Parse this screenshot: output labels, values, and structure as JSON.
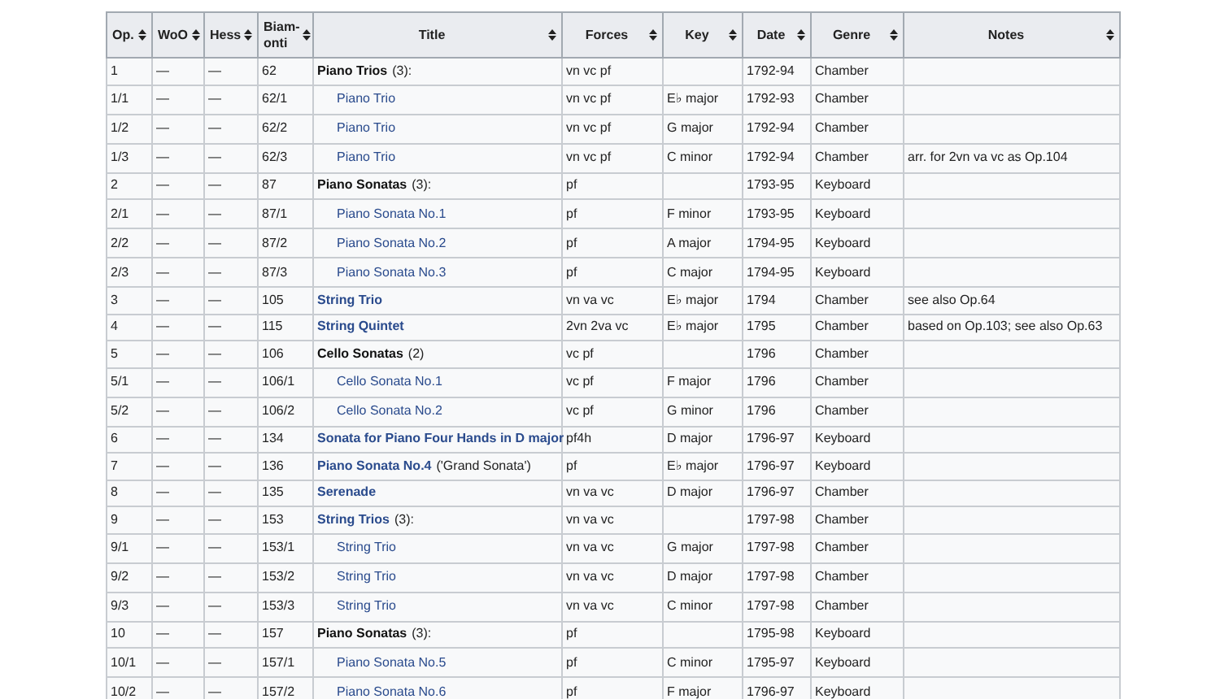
{
  "table": {
    "columns": [
      "Op.",
      "WoO",
      "Hess",
      "Biam- onti",
      "Title",
      "Forces",
      "Key",
      "Date",
      "Genre",
      "Notes"
    ],
    "rows": [
      {
        "op": "1",
        "woo": "—",
        "hess": "—",
        "biamonti": "62",
        "title": {
          "kind": "group",
          "link": false,
          "text": "Piano Trios",
          "suffix": "(3):"
        },
        "forces": "vn vc pf",
        "date": "1792-94",
        "genre": "Chamber"
      },
      {
        "op": "1/1",
        "woo": "—",
        "hess": "—",
        "biamonti": "62/1",
        "title": {
          "kind": "sub",
          "link": true,
          "text": "Piano Trio"
        },
        "forces": "vn vc pf",
        "key": "E♭ major",
        "date": "1792-93",
        "genre": "Chamber"
      },
      {
        "op": "1/2",
        "woo": "—",
        "hess": "—",
        "biamonti": "62/2",
        "title": {
          "kind": "sub",
          "link": true,
          "text": "Piano Trio"
        },
        "forces": "vn vc pf",
        "key": "G major",
        "date": "1792-94",
        "genre": "Chamber"
      },
      {
        "op": "1/3",
        "woo": "—",
        "hess": "—",
        "biamonti": "62/3",
        "title": {
          "kind": "sub",
          "link": true,
          "text": "Piano Trio"
        },
        "forces": "vn vc pf",
        "key": "C minor",
        "date": "1792-94",
        "genre": "Chamber",
        "notes": "arr. for 2vn va vc as Op.104"
      },
      {
        "op": "2",
        "woo": "—",
        "hess": "—",
        "biamonti": "87",
        "title": {
          "kind": "group",
          "link": false,
          "text": "Piano Sonatas",
          "suffix": "(3):"
        },
        "forces": "pf",
        "date": "1793-95",
        "genre": "Keyboard"
      },
      {
        "op": "2/1",
        "woo": "—",
        "hess": "—",
        "biamonti": "87/1",
        "title": {
          "kind": "sub",
          "link": true,
          "text": "Piano Sonata No.1"
        },
        "forces": "pf",
        "key": "F minor",
        "date": "1793-95",
        "genre": "Keyboard"
      },
      {
        "op": "2/2",
        "woo": "—",
        "hess": "—",
        "biamonti": "87/2",
        "title": {
          "kind": "sub",
          "link": true,
          "text": "Piano Sonata No.2"
        },
        "forces": "pf",
        "key": "A major",
        "date": "1794-95",
        "genre": "Keyboard"
      },
      {
        "op": "2/3",
        "woo": "—",
        "hess": "—",
        "biamonti": "87/3",
        "title": {
          "kind": "sub",
          "link": true,
          "text": "Piano Sonata No.3"
        },
        "forces": "pf",
        "key": "C major",
        "date": "1794-95",
        "genre": "Keyboard"
      },
      {
        "op": "3",
        "woo": "—",
        "hess": "—",
        "biamonti": "105",
        "title": {
          "kind": "group",
          "link": true,
          "text": "String Trio"
        },
        "forces": "vn va vc",
        "key": "E♭ major",
        "date": "1794",
        "genre": "Chamber",
        "notes": "see also Op.64"
      },
      {
        "op": "4",
        "woo": "—",
        "hess": "—",
        "biamonti": "115",
        "title": {
          "kind": "group",
          "link": true,
          "text": "String Quintet"
        },
        "forces": "2vn 2va vc",
        "key": "E♭ major",
        "date": "1795",
        "genre": "Chamber",
        "notes": "based on Op.103; see also Op.63"
      },
      {
        "op": "5",
        "woo": "—",
        "hess": "—",
        "biamonti": "106",
        "title": {
          "kind": "group",
          "link": false,
          "text": "Cello Sonatas",
          "suffix": "(2)"
        },
        "forces": "vc pf",
        "date": "1796",
        "genre": "Chamber"
      },
      {
        "op": "5/1",
        "woo": "—",
        "hess": "—",
        "biamonti": "106/1",
        "title": {
          "kind": "sub",
          "link": true,
          "text": "Cello Sonata No.1"
        },
        "forces": "vc pf",
        "key": "F major",
        "date": "1796",
        "genre": "Chamber"
      },
      {
        "op": "5/2",
        "woo": "—",
        "hess": "—",
        "biamonti": "106/2",
        "title": {
          "kind": "sub",
          "link": true,
          "text": "Cello Sonata No.2"
        },
        "forces": "vc pf",
        "key": "G minor",
        "date": "1796",
        "genre": "Chamber"
      },
      {
        "op": "6",
        "woo": "—",
        "hess": "—",
        "biamonti": "134",
        "title": {
          "kind": "group",
          "link": true,
          "text": "Sonata for Piano Four Hands in D major"
        },
        "forces": "pf4h",
        "key": "D major",
        "date": "1796-97",
        "genre": "Keyboard"
      },
      {
        "op": "7",
        "woo": "—",
        "hess": "—",
        "biamonti": "136",
        "title": {
          "kind": "group",
          "link": true,
          "text": "Piano Sonata No.4",
          "suffix": "('Grand Sonata')"
        },
        "forces": "pf",
        "key": "E♭ major",
        "date": "1796-97",
        "genre": "Keyboard"
      },
      {
        "op": "8",
        "woo": "—",
        "hess": "—",
        "biamonti": "135",
        "title": {
          "kind": "group",
          "link": true,
          "text": "Serenade"
        },
        "forces": "vn va vc",
        "key": "D major",
        "date": "1796-97",
        "genre": "Chamber"
      },
      {
        "op": "9",
        "woo": "—",
        "hess": "—",
        "biamonti": "153",
        "title": {
          "kind": "group",
          "link": true,
          "text": "String Trios",
          "suffix": "(3):"
        },
        "forces": "vn va vc",
        "date": "1797-98",
        "genre": "Chamber"
      },
      {
        "op": "9/1",
        "woo": "—",
        "hess": "—",
        "biamonti": "153/1",
        "title": {
          "kind": "sub",
          "link": true,
          "text": "String Trio"
        },
        "forces": "vn va vc",
        "key": "G major",
        "date": "1797-98",
        "genre": "Chamber"
      },
      {
        "op": "9/2",
        "woo": "—",
        "hess": "—",
        "biamonti": "153/2",
        "title": {
          "kind": "sub",
          "link": true,
          "text": "String Trio"
        },
        "forces": "vn va vc",
        "key": "D major",
        "date": "1797-98",
        "genre": "Chamber"
      },
      {
        "op": "9/3",
        "woo": "—",
        "hess": "—",
        "biamonti": "153/3",
        "title": {
          "kind": "sub",
          "link": true,
          "text": "String Trio"
        },
        "forces": "vn va vc",
        "key": "C minor",
        "date": "1797-98",
        "genre": "Chamber"
      },
      {
        "op": "10",
        "woo": "—",
        "hess": "—",
        "biamonti": "157",
        "title": {
          "kind": "group",
          "link": false,
          "text": "Piano Sonatas",
          "suffix": "(3):"
        },
        "forces": "pf",
        "date": "1795-98",
        "genre": "Keyboard"
      },
      {
        "op": "10/1",
        "woo": "—",
        "hess": "—",
        "biamonti": "157/1",
        "title": {
          "kind": "sub",
          "link": true,
          "text": "Piano Sonata No.5"
        },
        "forces": "pf",
        "key": "C minor",
        "date": "1795-97",
        "genre": "Keyboard"
      },
      {
        "op": "10/2",
        "woo": "—",
        "hess": "—",
        "biamonti": "157/2",
        "title": {
          "kind": "sub",
          "link": true,
          "text": "Piano Sonata No.6"
        },
        "forces": "pf",
        "key": "F major",
        "date": "1796-97",
        "genre": "Keyboard"
      }
    ]
  }
}
